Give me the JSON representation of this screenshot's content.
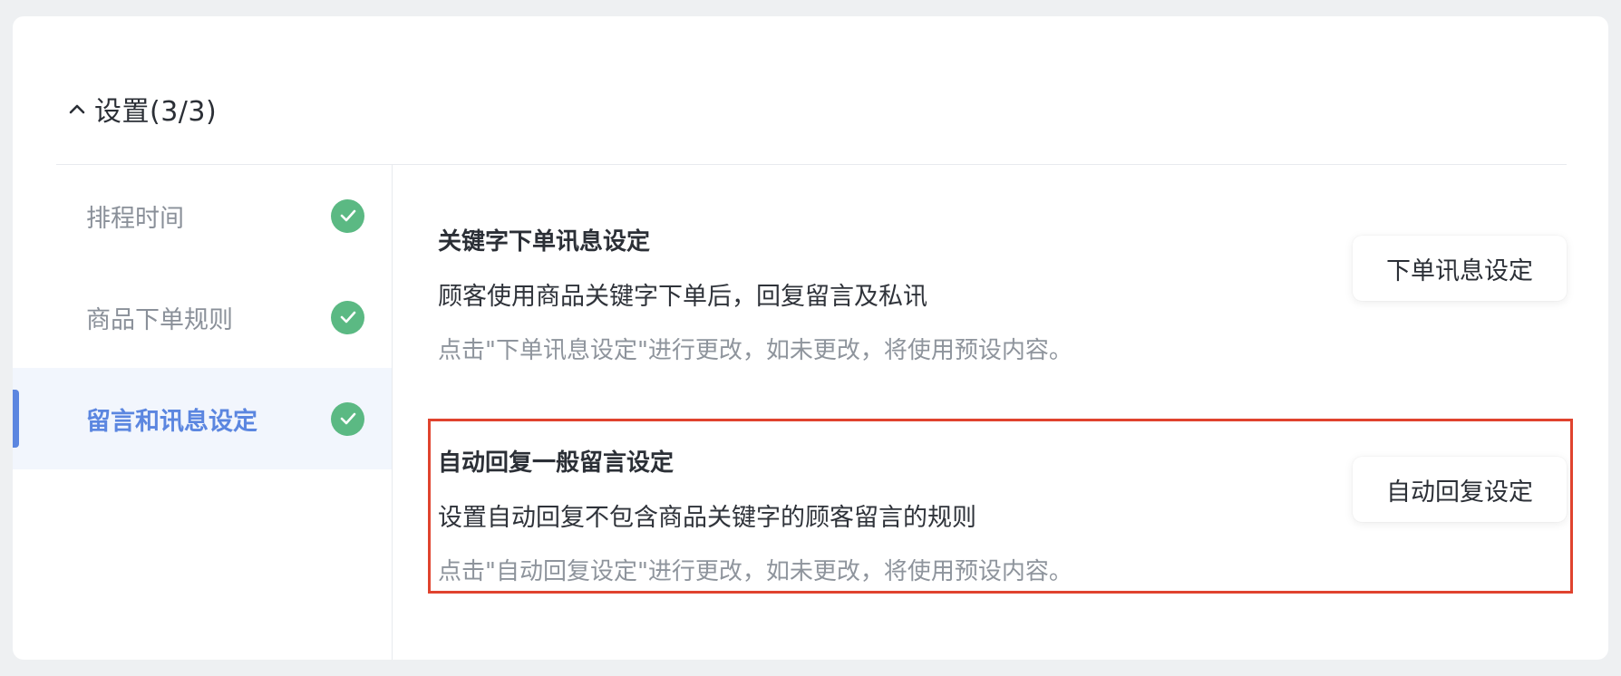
{
  "header": {
    "title": "设置(3/3)"
  },
  "sidebar": {
    "items": [
      {
        "label": "排程时间",
        "completed": true,
        "active": false
      },
      {
        "label": "商品下单规则",
        "completed": true,
        "active": false
      },
      {
        "label": "留言和讯息设定",
        "completed": true,
        "active": true
      }
    ]
  },
  "sections": [
    {
      "title": "关键字下单讯息设定",
      "description": "顾客使用商品关键字下单后，回复留言及私讯",
      "hint": "点击\"下单讯息设定\"进行更改，如未更改，将使用预设内容。",
      "button_label": "下单讯息设定"
    },
    {
      "title": "自动回复一般留言设定",
      "description": "设置自动回复不包含商品关键字的顾客留言的规则",
      "hint": "点击\"自动回复设定\"进行更改，如未更改，将使用预设内容。",
      "button_label": "自动回复设定"
    }
  ],
  "colors": {
    "accent": "#5b86e0",
    "success": "#5bb983",
    "highlight_border": "#e0432e",
    "background": "#eef0f2"
  },
  "icons": {
    "collapse": "chevron-up-icon",
    "completed": "check-circle-icon"
  }
}
